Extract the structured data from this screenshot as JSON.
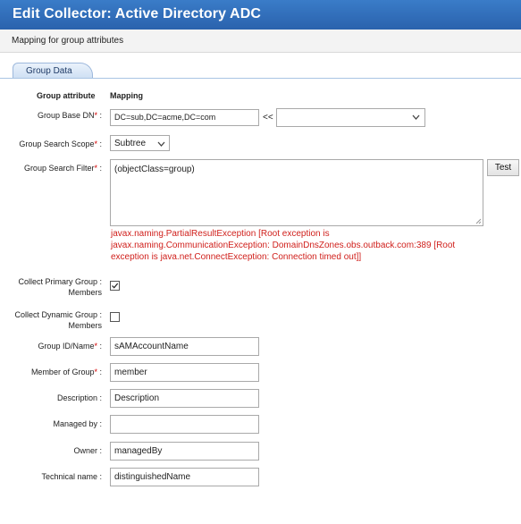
{
  "window": {
    "title": "Edit Collector: Active Directory ADC"
  },
  "subheader": {
    "text": "Mapping for group attributes"
  },
  "tabs": [
    {
      "label": "Group Data",
      "active": true
    }
  ],
  "columns": {
    "attribute": "Group attribute",
    "mapping": "Mapping"
  },
  "fields": {
    "base_dn": {
      "label": "Group Base DN",
      "required": "*",
      "sep": " :",
      "value": "DC=sub,DC=acme,DC=com",
      "transfer": "<<",
      "dropdown_value": ""
    },
    "search_scope": {
      "label": "Group Search Scope",
      "required": "*",
      "sep": " :",
      "value": "Subtree"
    },
    "search_filter": {
      "label": "Group Search Filter",
      "required": "*",
      "sep": " :",
      "value": "(objectClass=group)",
      "test_button": "Test"
    },
    "error": "javax.naming.PartialResultException [Root exception is javax.naming.CommunicationException: DomainDnsZones.obs.outback.com:389 [Root exception is java.net.ConnectException: Connection timed out]]",
    "collect_primary": {
      "label_line1": "Collect Primary Group :",
      "label_line2": "Members",
      "checked": true
    },
    "collect_dynamic": {
      "label_line1": "Collect Dynamic Group :",
      "label_line2": "Members",
      "checked": false
    },
    "group_id": {
      "label": "Group ID/Name",
      "required": "*",
      "sep": " :",
      "value": "sAMAccountName"
    },
    "member_of": {
      "label": "Member of Group",
      "required": "*",
      "sep": " :",
      "value": "member"
    },
    "description": {
      "label": "Description :",
      "value": "Description"
    },
    "managed_by": {
      "label": "Managed by :",
      "value": ""
    },
    "owner": {
      "label": "Owner :",
      "value": "managedBy"
    },
    "technical_name": {
      "label": "Technical name :",
      "value": "distinguishedName"
    }
  },
  "colors": {
    "titlebar": "#2a62ad",
    "error": "#d0201c",
    "required": "#d40000"
  }
}
